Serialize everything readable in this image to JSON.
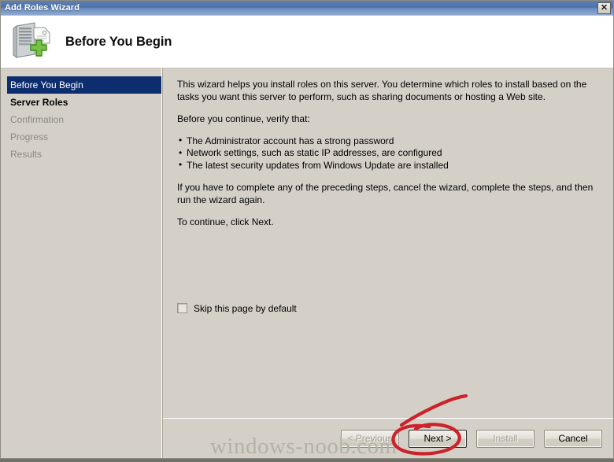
{
  "window": {
    "title": "Add Roles Wizard",
    "close_label": "✕"
  },
  "header": {
    "title": "Before You Begin",
    "icon": "server-add-icon"
  },
  "sidebar": {
    "items": [
      {
        "label": "Before You Begin",
        "state": "selected"
      },
      {
        "label": "Server Roles",
        "state": "done"
      },
      {
        "label": "Confirmation",
        "state": "upcoming"
      },
      {
        "label": "Progress",
        "state": "upcoming"
      },
      {
        "label": "Results",
        "state": "upcoming"
      }
    ]
  },
  "content": {
    "intro": "This wizard helps you install roles on this server. You determine which roles to install based on the tasks you want this server to perform, such as sharing documents or hosting a Web site.",
    "verify_heading": "Before you continue, verify that:",
    "checklist": [
      "The Administrator account has a strong password",
      "Network settings, such as static IP addresses, are configured",
      "The latest security updates from Windows Update are installed"
    ],
    "cancel_note": "If you have to complete any of the preceding steps, cancel the wizard, complete the steps, and then run the wizard again.",
    "continue_note": "To continue, click Next.",
    "skip_checkbox_label": "Skip this page by default",
    "skip_checkbox_checked": false
  },
  "footer": {
    "buttons": [
      {
        "label": "< Previous",
        "state": "disabled"
      },
      {
        "label": "Next >",
        "state": "default"
      },
      {
        "label": "Install",
        "state": "disabled"
      },
      {
        "label": "Cancel",
        "state": "enabled"
      }
    ]
  },
  "watermark": {
    "text": "windows-noob.com"
  },
  "annotation": {
    "color": "#cc2229",
    "shape": "circle-around-next-button-with-diagonal-stroke"
  },
  "colors": {
    "titlebar_blue": "#4d72aa",
    "selection_blue": "#0d2e6e",
    "surface_gray": "#d4d0c8",
    "annotation_red": "#cc2229"
  }
}
